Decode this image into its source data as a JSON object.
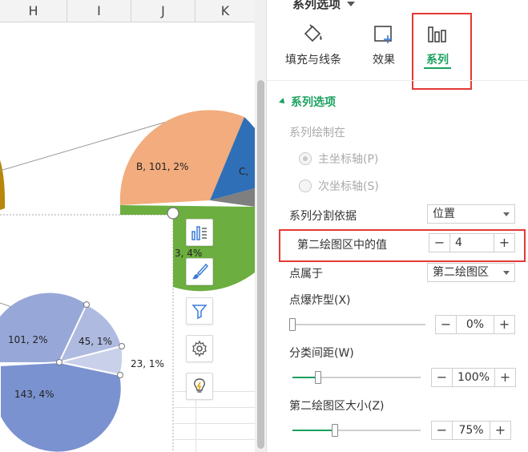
{
  "sheet": {
    "columns": [
      "H",
      "I",
      "J",
      "K"
    ],
    "chart_labels": {
      "b_slice": "B, 101, 2%",
      "c_slice": "C,",
      "d_slice": "3, 4%",
      "sub_101": "101, 2%",
      "sub_45": "45, 1%",
      "sub_23": "23, 1%",
      "sub_143": "143, 4%"
    },
    "tools": {
      "chart_elements": "chart-elements-icon",
      "chart_style": "brush-icon",
      "chart_filter": "filter-icon",
      "chart_settings": "gear-icon",
      "chart_ideas": "lightbulb-icon"
    }
  },
  "panel": {
    "title": "系列选项",
    "tabs": [
      {
        "label": "填充与线条",
        "icon": "fill-bucket-icon",
        "active": false
      },
      {
        "label": "效果",
        "icon": "effects-icon",
        "active": false
      },
      {
        "label": "系列",
        "icon": "series-bars-icon",
        "active": true
      }
    ],
    "section": "系列选项",
    "plot_on": {
      "label": "系列绘制在",
      "primary": "主坐标轴(P)",
      "secondary": "次坐标轴(S)",
      "selected": "primary"
    },
    "split_by": {
      "label": "系列分割依据",
      "value": "位置"
    },
    "second_plot_values": {
      "label": "第二绘图区中的值",
      "value": "4"
    },
    "point_belongs": {
      "label": "点属于",
      "value": "第二绘图区"
    },
    "explosion": {
      "label": "点爆炸型(X)",
      "value": "0%",
      "fraction": 0
    },
    "gap_width": {
      "label": "分类间距(W)",
      "value": "100%",
      "fraction": 0.2
    },
    "second_plot_size": {
      "label": "第二绘图区大小(Z)",
      "value": "75%",
      "fraction": 0.33
    }
  },
  "colors": {
    "accent": "#1aa15f",
    "highlight": "#e53935",
    "slice_b": "#f2ac7d",
    "slice_c": "#2f6fb7",
    "slice_green": "#6cae3f",
    "sub_pie_main": "#8b9fd6",
    "sub_pie_large": "#7b92d0",
    "sub_pie_light": "#a9b6de",
    "sub_pie_lighter": "#c5cde9"
  }
}
